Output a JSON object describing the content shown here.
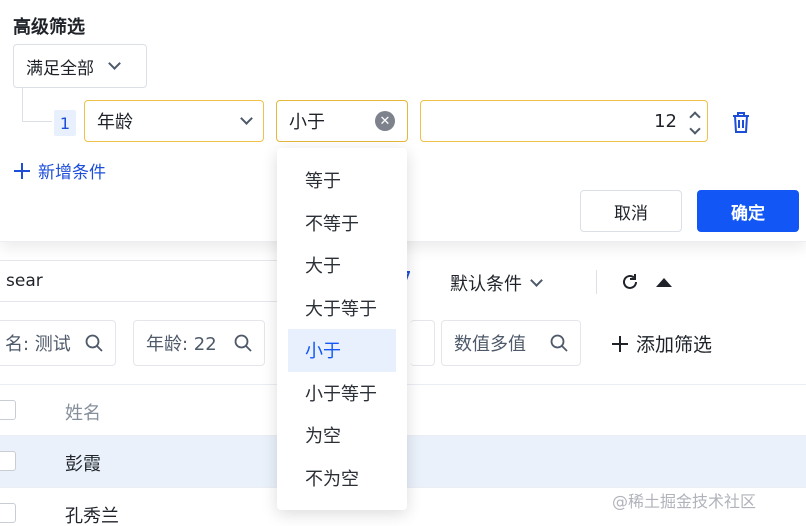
{
  "panel": {
    "title": "高级筛选",
    "match_mode": "满足全部",
    "condition": {
      "index": "1",
      "field": "年龄",
      "operator": "小于",
      "value": "12"
    },
    "add_condition_label": "新增条件",
    "cancel_label": "取消",
    "confirm_label": "确定"
  },
  "dropdown": {
    "options": [
      "等于",
      "不等于",
      "大于",
      "大于等于",
      "小于",
      "小于等于",
      "为空",
      "不为空"
    ],
    "selected": "小于"
  },
  "toolbar": {
    "search_value": "sear",
    "default_condition_label": "默认条件",
    "add_filter_label": "添加筛选"
  },
  "filter_chips": [
    {
      "text": "名: 测试"
    },
    {
      "text": "年龄: 22"
    },
    {
      "text": "数值多值"
    }
  ],
  "table": {
    "header_name": "姓名",
    "rows": [
      {
        "name": "彭霞"
      },
      {
        "name": "孔秀兰"
      }
    ]
  },
  "watermark": "@稀土掘金技术社区",
  "colors": {
    "primary": "#1256f5",
    "focus_border": "#f0c24a",
    "selected_row": "#eaf1fb"
  }
}
